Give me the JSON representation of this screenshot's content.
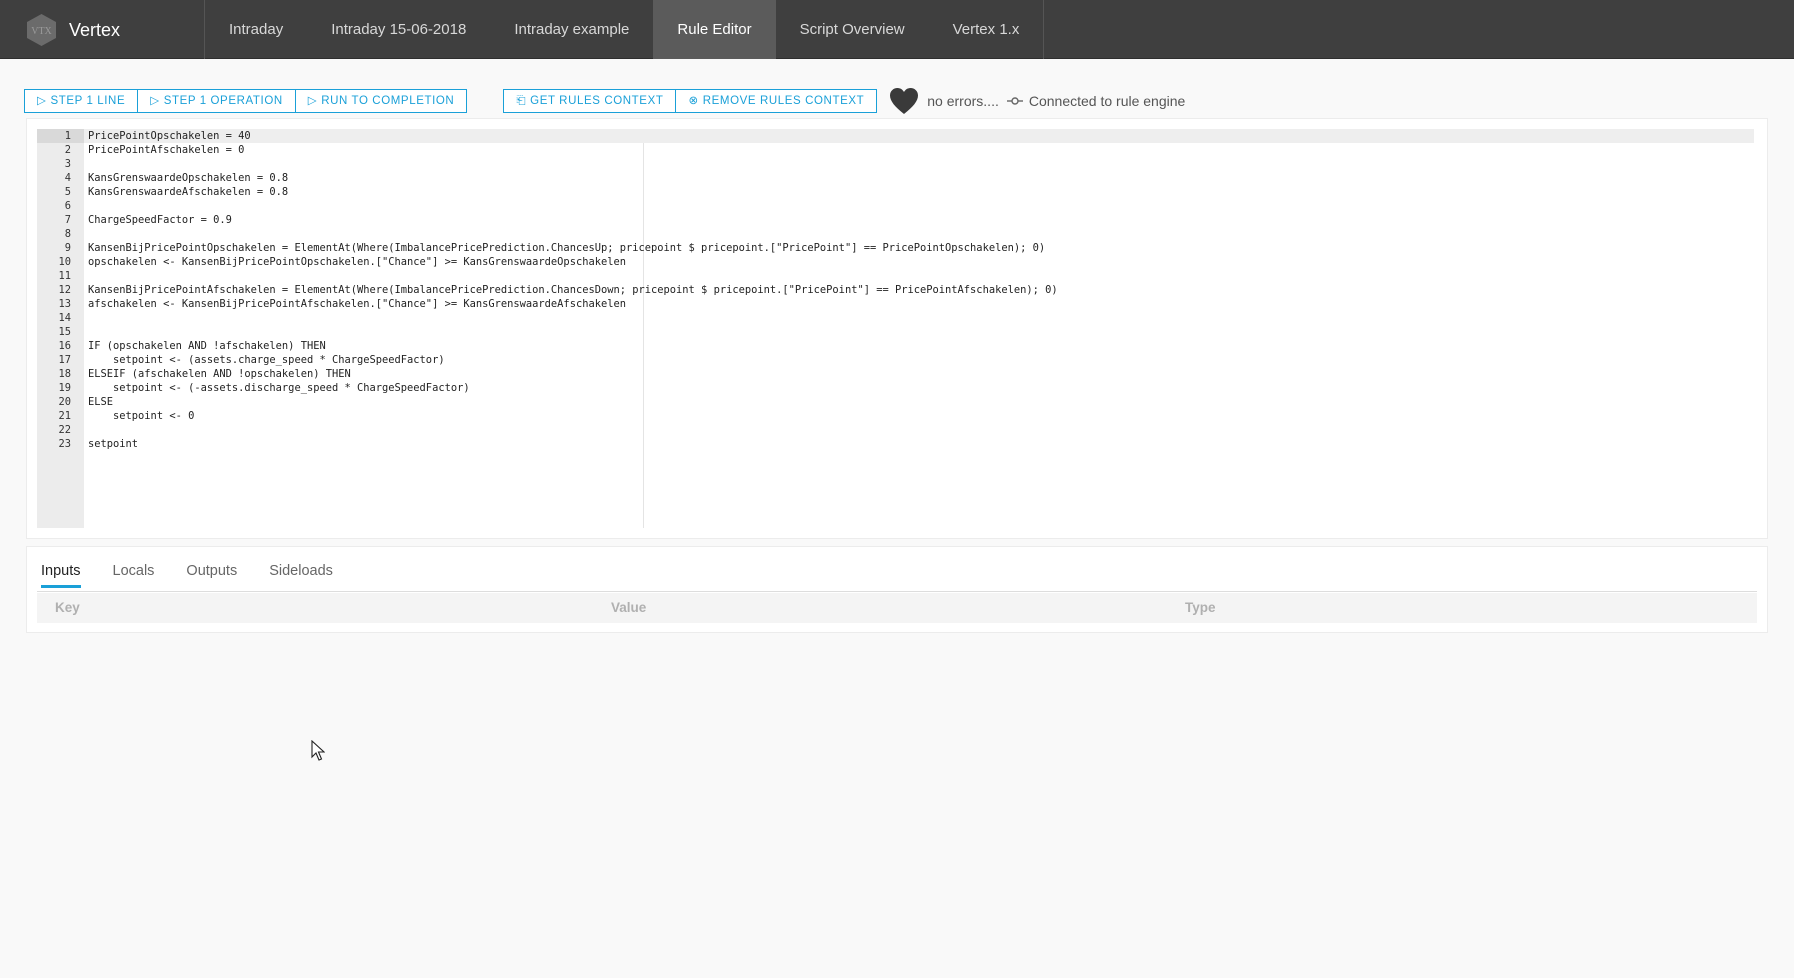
{
  "app": {
    "name": "Vertex",
    "logo_text": "VTX"
  },
  "nav": {
    "items": [
      {
        "label": "Intraday",
        "active": false
      },
      {
        "label": "Intraday 15-06-2018",
        "active": false
      },
      {
        "label": "Intraday example",
        "active": false
      },
      {
        "label": "Rule Editor",
        "active": true
      },
      {
        "label": "Script Overview",
        "active": false
      },
      {
        "label": "Vertex 1.x",
        "active": false
      }
    ]
  },
  "toolbar": {
    "step_line_label": "STEP 1 LINE",
    "step_operation_label": "STEP 1 OPERATION",
    "run_label": "RUN TO COMPLETION",
    "get_context_label": "GET RULES CONTEXT",
    "remove_context_label": "REMOVE RULES CONTEXT",
    "status_text": "no errors....",
    "connection_text": "Connected to rule engine",
    "accent_color": "#1aa0d8"
  },
  "editor": {
    "current_line": 1,
    "lines": [
      "PricePointOpschakelen = 40",
      "PricePointAfschakelen = 0",
      "",
      "KansGrenswaardeOpschakelen = 0.8",
      "KansGrenswaardeAfschakelen = 0.8",
      "",
      "ChargeSpeedFactor = 0.9",
      "",
      "KansenBijPricePointOpschakelen = ElementAt(Where(ImbalancePricePrediction.ChancesUp; pricepoint $ pricepoint.[\"PricePoint\"] == PricePointOpschakelen); 0)",
      "opschakelen <- KansenBijPricePointOpschakelen.[\"Chance\"] >= KansGrenswaardeOpschakelen",
      "",
      "KansenBijPricePointAfschakelen = ElementAt(Where(ImbalancePricePrediction.ChancesDown; pricepoint $ pricepoint.[\"PricePoint\"] == PricePointAfschakelen); 0)",
      "afschakelen <- KansenBijPricePointAfschakelen.[\"Chance\"] >= KansGrenswaardeAfschakelen",
      "",
      "",
      "IF (opschakelen AND !afschakelen) THEN",
      "    setpoint <- (assets.charge_speed * ChargeSpeedFactor)",
      "ELSEIF (afschakelen AND !opschakelen) THEN",
      "    setpoint <- (-assets.discharge_speed * ChargeSpeedFactor)",
      "ELSE",
      "    setpoint <- 0",
      "",
      "setpoint"
    ]
  },
  "panel": {
    "tabs": [
      {
        "label": "Inputs",
        "active": true
      },
      {
        "label": "Locals",
        "active": false
      },
      {
        "label": "Outputs",
        "active": false
      },
      {
        "label": "Sideloads",
        "active": false
      }
    ],
    "columns": {
      "key": "Key",
      "value": "Value",
      "type": "Type"
    }
  }
}
